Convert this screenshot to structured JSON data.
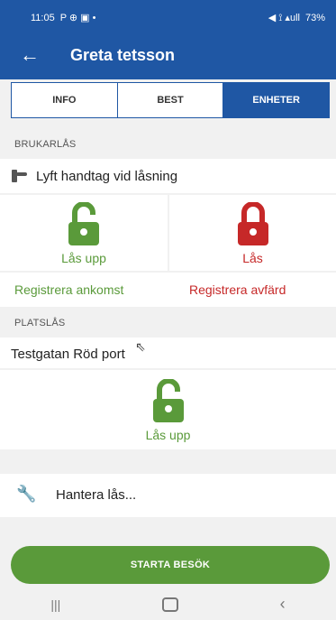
{
  "status_bar": {
    "time": "11:05",
    "left_icons": "P ⊕ ▣ •",
    "right_icons": "◀ ⟟ ▴ull",
    "battery": "73%"
  },
  "app_bar": {
    "title": "Greta tetsson"
  },
  "tabs": [
    {
      "label": "INFO"
    },
    {
      "label": "BEST"
    },
    {
      "label": "ENHETER",
      "active": true
    }
  ],
  "brukarlas": {
    "header": "BRUKARLÅS",
    "lock_name": "Lyft handtag vid låsning",
    "unlock_label": "Lås upp",
    "lock_label": "Lås",
    "register_arrival": "Registrera ankomst",
    "register_departure": "Registrera avfärd"
  },
  "platslas": {
    "header": "PLATSLÅS",
    "lock_name": "Testgatan Röd port",
    "unlock_label": "Lås upp"
  },
  "manage": {
    "label": "Hantera lås..."
  },
  "start_button": {
    "label": "STARTA BESÖK"
  },
  "colors": {
    "primary": "#1f57a4",
    "green": "#5a9a3a",
    "red": "#c62828"
  }
}
